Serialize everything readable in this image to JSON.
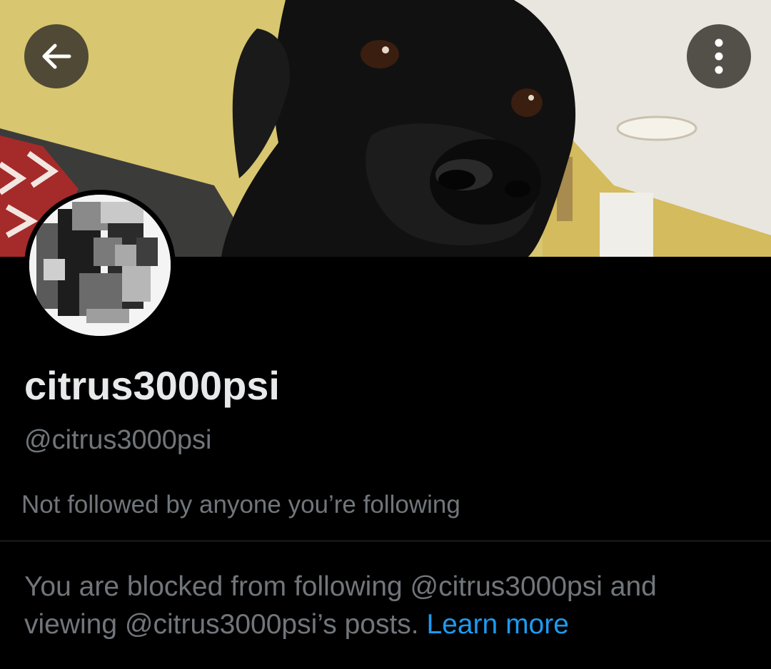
{
  "header": {
    "back_icon": "arrow-left-icon",
    "more_icon": "more-vertical-icon"
  },
  "profile": {
    "display_name": "citrus3000psi",
    "handle": "@citrus3000psi",
    "followers_note": "Not followed by anyone you’re following",
    "blocked_message": "You are blocked from following @citrus3000psi and viewing @citrus3000psi’s posts.",
    "learn_more_label": "Learn more"
  },
  "colors": {
    "background": "#000000",
    "primary_text": "#e7e9ea",
    "secondary_text": "#71767b",
    "link": "#1d9bf0",
    "divider": "#2f3336"
  }
}
